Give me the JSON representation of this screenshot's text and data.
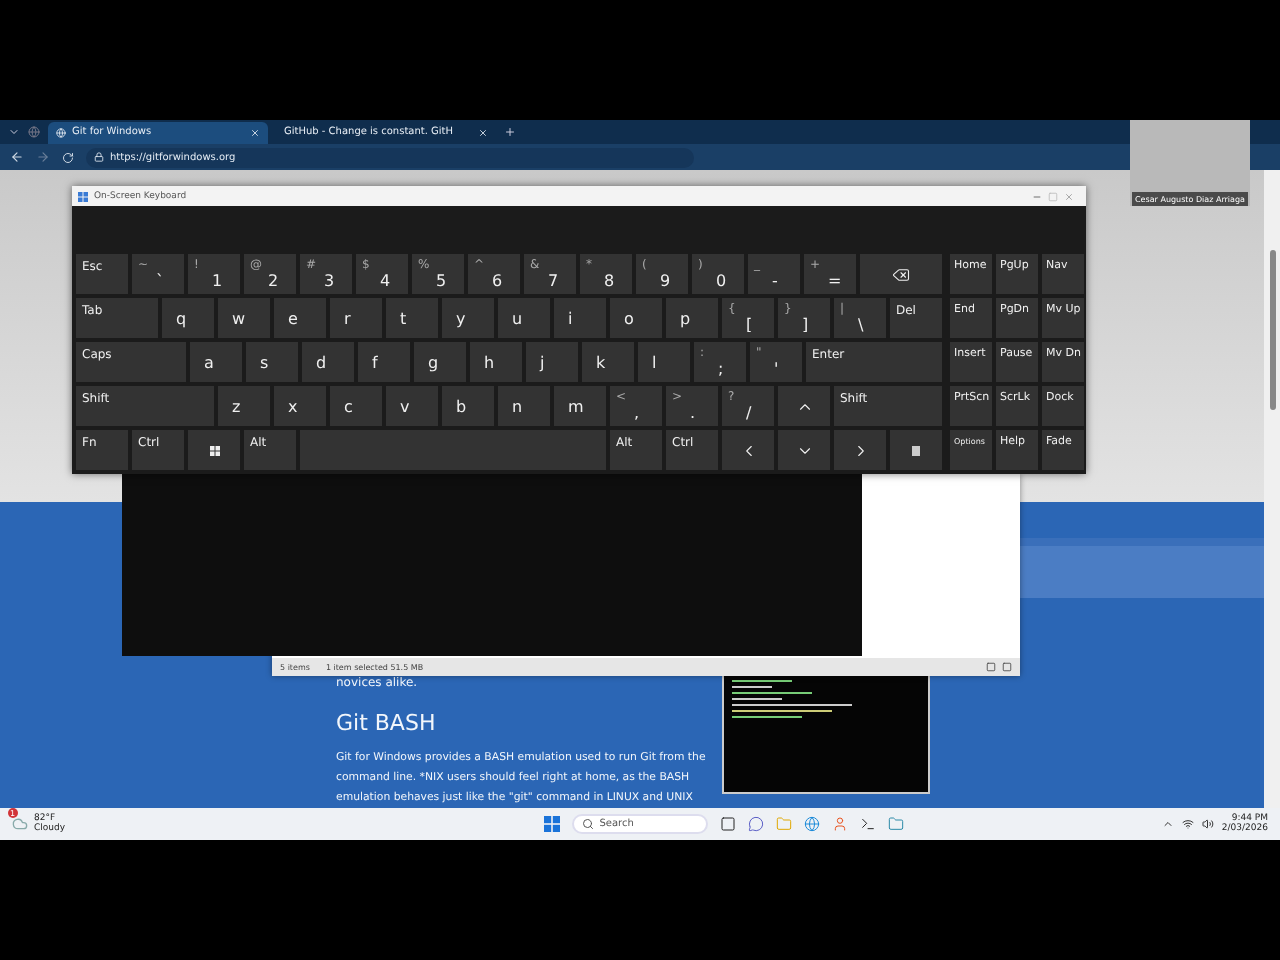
{
  "browser": {
    "tabs": [
      {
        "title": "Git for Windows",
        "selected": true
      },
      {
        "title": "GitHub - Change is constant. GitH",
        "selected": false
      }
    ],
    "address": "https://gitforwindows.org"
  },
  "webcam": {
    "name": "Cesar Augusto Diaz Arriaga"
  },
  "keyboard": {
    "title": "On-Screen Keyboard",
    "rows": [
      [
        {
          "kind": "mod",
          "label": "Esc"
        },
        {
          "kind": "char",
          "shift": "~",
          "label": "`"
        },
        {
          "kind": "char",
          "shift": "!",
          "label": "1"
        },
        {
          "kind": "char",
          "shift": "@",
          "label": "2"
        },
        {
          "kind": "char",
          "shift": "#",
          "label": "3"
        },
        {
          "kind": "char",
          "shift": "$",
          "label": "4"
        },
        {
          "kind": "char",
          "shift": "%",
          "label": "5"
        },
        {
          "kind": "char",
          "shift": "^",
          "label": "6"
        },
        {
          "kind": "char",
          "shift": "&",
          "label": "7"
        },
        {
          "kind": "char",
          "shift": "*",
          "label": "8"
        },
        {
          "kind": "char",
          "shift": "(",
          "label": "9"
        },
        {
          "kind": "char",
          "shift": ")",
          "label": "0"
        },
        {
          "kind": "char",
          "shift": "_",
          "label": "-"
        },
        {
          "kind": "char",
          "shift": "+",
          "label": "="
        },
        {
          "kind": "backspace"
        }
      ],
      [
        {
          "kind": "mod",
          "label": "Tab"
        },
        {
          "kind": "letter",
          "label": "q"
        },
        {
          "kind": "letter",
          "label": "w"
        },
        {
          "kind": "letter",
          "label": "e"
        },
        {
          "kind": "letter",
          "label": "r"
        },
        {
          "kind": "letter",
          "label": "t"
        },
        {
          "kind": "letter",
          "label": "y"
        },
        {
          "kind": "letter",
          "label": "u"
        },
        {
          "kind": "letter",
          "label": "i"
        },
        {
          "kind": "letter",
          "label": "o"
        },
        {
          "kind": "letter",
          "label": "p"
        },
        {
          "kind": "char",
          "shift": "{",
          "label": "["
        },
        {
          "kind": "char",
          "shift": "}",
          "label": "]"
        },
        {
          "kind": "char",
          "shift": "|",
          "label": "\\"
        },
        {
          "kind": "mod",
          "label": "Del"
        }
      ],
      [
        {
          "kind": "mod",
          "label": "Caps"
        },
        {
          "kind": "letter",
          "label": "a"
        },
        {
          "kind": "letter",
          "label": "s"
        },
        {
          "kind": "letter",
          "label": "d"
        },
        {
          "kind": "letter",
          "label": "f"
        },
        {
          "kind": "letter",
          "label": "g"
        },
        {
          "kind": "letter",
          "label": "h"
        },
        {
          "kind": "letter",
          "label": "j"
        },
        {
          "kind": "letter",
          "label": "k"
        },
        {
          "kind": "letter",
          "label": "l"
        },
        {
          "kind": "char",
          "shift": ":",
          "label": ";"
        },
        {
          "kind": "char",
          "shift": "\"",
          "label": "'"
        },
        {
          "kind": "mod",
          "label": "Enter"
        }
      ],
      [
        {
          "kind": "mod",
          "label": "Shift"
        },
        {
          "kind": "letter",
          "label": "z"
        },
        {
          "kind": "letter",
          "label": "x"
        },
        {
          "kind": "letter",
          "label": "c"
        },
        {
          "kind": "letter",
          "label": "v"
        },
        {
          "kind": "letter",
          "label": "b"
        },
        {
          "kind": "letter",
          "label": "n"
        },
        {
          "kind": "letter",
          "label": "m"
        },
        {
          "kind": "char",
          "shift": "<",
          "label": ","
        },
        {
          "kind": "char",
          "shift": ">",
          "label": "."
        },
        {
          "kind": "char",
          "shift": "?",
          "label": "/"
        },
        {
          "kind": "up"
        },
        {
          "kind": "mod",
          "label": "Shift"
        }
      ],
      [
        {
          "kind": "mod",
          "label": "Fn"
        },
        {
          "kind": "mod",
          "label": "Ctrl"
        },
        {
          "kind": "windows"
        },
        {
          "kind": "mod",
          "label": "Alt"
        },
        {
          "kind": "space"
        },
        {
          "kind": "mod",
          "label": "Alt"
        },
        {
          "kind": "mod",
          "label": "Ctrl"
        },
        {
          "kind": "left"
        },
        {
          "kind": "down"
        },
        {
          "kind": "right"
        },
        {
          "kind": "menu"
        }
      ]
    ],
    "nav_rows": [
      [
        "Home",
        "PgUp",
        "Nav"
      ],
      [
        "End",
        "PgDn",
        "Mv Up"
      ],
      [
        "Insert",
        "Pause",
        "Mv Dn"
      ],
      [
        "PrtScn",
        "ScrLk",
        "Dock"
      ],
      [
        "Options",
        "Help",
        "Fade"
      ]
    ]
  },
  "explorer": {
    "status": [
      "5 items",
      "1 item selected  51.5 MB"
    ]
  },
  "page": {
    "intro": "novices alike.",
    "heading": "Git BASH",
    "paragraph": "Git for Windows provides a BASH emulation used to run Git from the command line. *NIX users should feel right at home, as the BASH emulation behaves just like the \"git\" command in LINUX and UNIX"
  },
  "taskbar": {
    "weather": {
      "badge": "1",
      "temp": "82°F",
      "condition": "Cloudy"
    },
    "search": {
      "placeholder": "Search"
    },
    "time": "9:44 PM",
    "date": "2/03/2026"
  }
}
